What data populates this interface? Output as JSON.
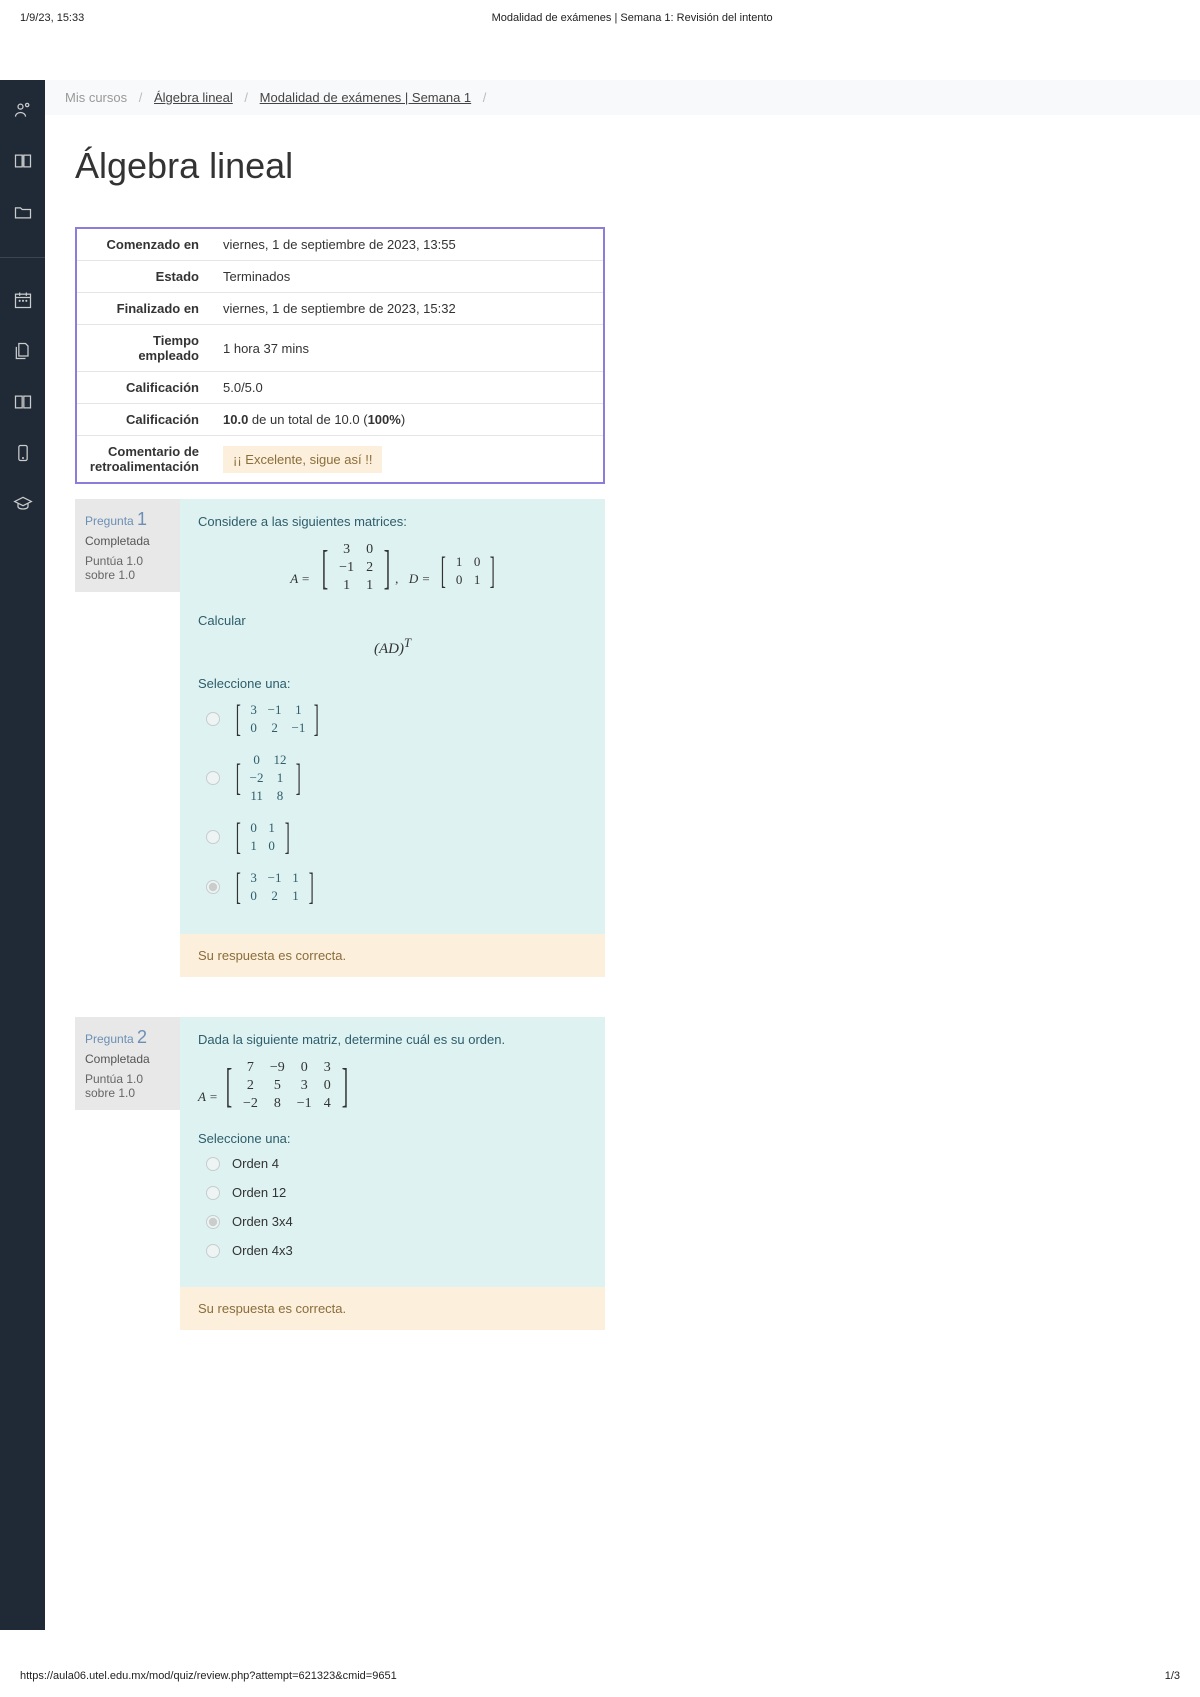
{
  "print_header": {
    "left": "1/9/23, 15:33",
    "center": "Modalidad de exámenes | Semana 1: Revisión del intento"
  },
  "breadcrumb": {
    "item1": "Mis cursos",
    "item2": "Álgebra lineal",
    "item3": "Modalidad de exámenes | Semana 1"
  },
  "page_title": "Álgebra lineal",
  "summary": {
    "rows": [
      {
        "label": "Comenzado en",
        "value": "viernes, 1 de septiembre de 2023, 13:55"
      },
      {
        "label": "Estado",
        "value": "Terminados"
      },
      {
        "label": "Finalizado en",
        "value": "viernes, 1 de septiembre de 2023, 15:32"
      },
      {
        "label": "Tiempo empleado",
        "value": "1 hora 37 mins"
      },
      {
        "label": "Calificación",
        "value": "5.0/5.0"
      }
    ],
    "grade_label": "Calificación",
    "grade_value_prefix": "10.0",
    "grade_value_mid": " de un total de 10.0 (",
    "grade_value_bold": "100%",
    "grade_value_suffix": ")",
    "feedback_label": "Comentario de retroalimentación",
    "feedback_text": "¡¡ Excelente, sigue así !!"
  },
  "q1": {
    "num_label": "Pregunta ",
    "num": "1",
    "status": "Completada",
    "score": "Puntúa 1.0 sobre 1.0",
    "prompt": "Considere a las siguientes matrices:",
    "matrixA_label": "A =",
    "matrixA": [
      [
        "3",
        "0"
      ],
      [
        "−1",
        "2"
      ],
      [
        "1",
        "1"
      ]
    ],
    "comma": ",",
    "matrixD_label": "D =",
    "matrixD": [
      [
        "1",
        "0"
      ],
      [
        "0",
        "1"
      ]
    ],
    "calcular": "Calcular",
    "formula": "(AD)",
    "formula_sup": "T",
    "select_label": "Seleccione una:",
    "options": [
      {
        "selected": false,
        "matrix": [
          [
            "3",
            "−1",
            "1"
          ],
          [
            "0",
            "2",
            "−1"
          ]
        ]
      },
      {
        "selected": false,
        "matrix": [
          [
            "0",
            "12"
          ],
          [
            "−2",
            "1"
          ],
          [
            "11",
            "8"
          ]
        ]
      },
      {
        "selected": false,
        "matrix": [
          [
            "0",
            "1"
          ],
          [
            "1",
            "0"
          ]
        ]
      },
      {
        "selected": true,
        "matrix": [
          [
            "3",
            "−1",
            "1"
          ],
          [
            "0",
            "2",
            "1"
          ]
        ]
      }
    ],
    "feedback": "Su respuesta es correcta."
  },
  "q2": {
    "num_label": "Pregunta ",
    "num": "2",
    "status": "Completada",
    "score": "Puntúa 1.0 sobre 1.0",
    "prompt": "Dada la siguiente matriz, determine cuál es su orden.",
    "matrixA_label": "A =",
    "matrixA": [
      [
        "7",
        "−9",
        "0",
        "3"
      ],
      [
        "2",
        "5",
        "3",
        "0"
      ],
      [
        "−2",
        "8",
        "−1",
        "4"
      ]
    ],
    "select_label": "Seleccione una:",
    "options": [
      {
        "selected": false,
        "text": "Orden 4"
      },
      {
        "selected": false,
        "text": "Orden 12"
      },
      {
        "selected": true,
        "text": "Orden 3x4"
      },
      {
        "selected": false,
        "text": "Orden 4x3"
      }
    ],
    "feedback": "Su respuesta es correcta."
  },
  "footer": {
    "url": "https://aula06.utel.edu.mx/mod/quiz/review.php?attempt=621323&cmid=9651",
    "page": "1/3"
  }
}
